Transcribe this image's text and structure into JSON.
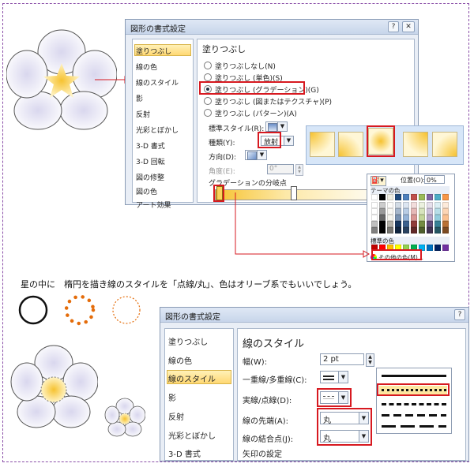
{
  "dialog1": {
    "title": "図形の書式設定",
    "help": "?",
    "nav": [
      "塗りつぶし",
      "線の色",
      "線のスタイル",
      "影",
      "反射",
      "光彩とぼかし",
      "3-D 書式",
      "3-D 回転",
      "図の修整",
      "図の色",
      "アート効果"
    ],
    "section_title": "塗りつぶし",
    "fill_options": [
      "塗りつぶしなし(N)",
      "塗りつぶし (単色)(S)",
      "塗りつぶし (グラデーション)(G)",
      "塗りつぶし (図またはテクスチャ)(P)",
      "塗りつぶし (パターン)(A)"
    ],
    "preset_label": "標準スタイル(R):",
    "type_label": "種類(Y):",
    "type_value": "放射",
    "direction_label": "方向(D):",
    "angle_label": "角度(E):",
    "angle_value": "0°",
    "stops_label": "グラデーションの分岐点"
  },
  "color_popup": {
    "position_label": "位置(O):",
    "position_value": "0%",
    "theme_label": "テーマの色",
    "standard_label": "標準の色",
    "more_label": "その他の色(M)...",
    "theme_colors": [
      "#ffffff",
      "#000000",
      "#eeece1",
      "#1f497d",
      "#4f81bd",
      "#c0504d",
      "#9bbb59",
      "#8064a2",
      "#4bacc6",
      "#f79646"
    ],
    "standard_colors": [
      "#c00000",
      "#ff0000",
      "#ffc000",
      "#ffff00",
      "#92d050",
      "#00b050",
      "#00b0f0",
      "#0070c0",
      "#002060",
      "#7030a0"
    ]
  },
  "instruction_text": "星の中に　楕円を描き線のスタイルを「点線/丸」、色はオリーブ系でもいいでしょう。",
  "dialog2": {
    "title": "図形の書式設定",
    "help": "?",
    "nav": [
      "塗りつぶし",
      "線の色",
      "線のスタイル",
      "影",
      "反射",
      "光彩とぼかし",
      "3-D 書式"
    ],
    "section_title": "線のスタイル",
    "width_label": "幅(W):",
    "width_value": "2 pt",
    "compound_label": "一重線/多重線(C):",
    "dash_label": "実線/点線(D):",
    "cap_label": "線の先端(A):",
    "cap_value": "丸",
    "join_label": "線の結合点(J):",
    "join_value": "丸",
    "arrow_label": "矢印の設定"
  },
  "colors": {
    "accent_red": "#d71920",
    "dot_orange": "#e46c0a",
    "star_yellow": "#f7c63e"
  }
}
